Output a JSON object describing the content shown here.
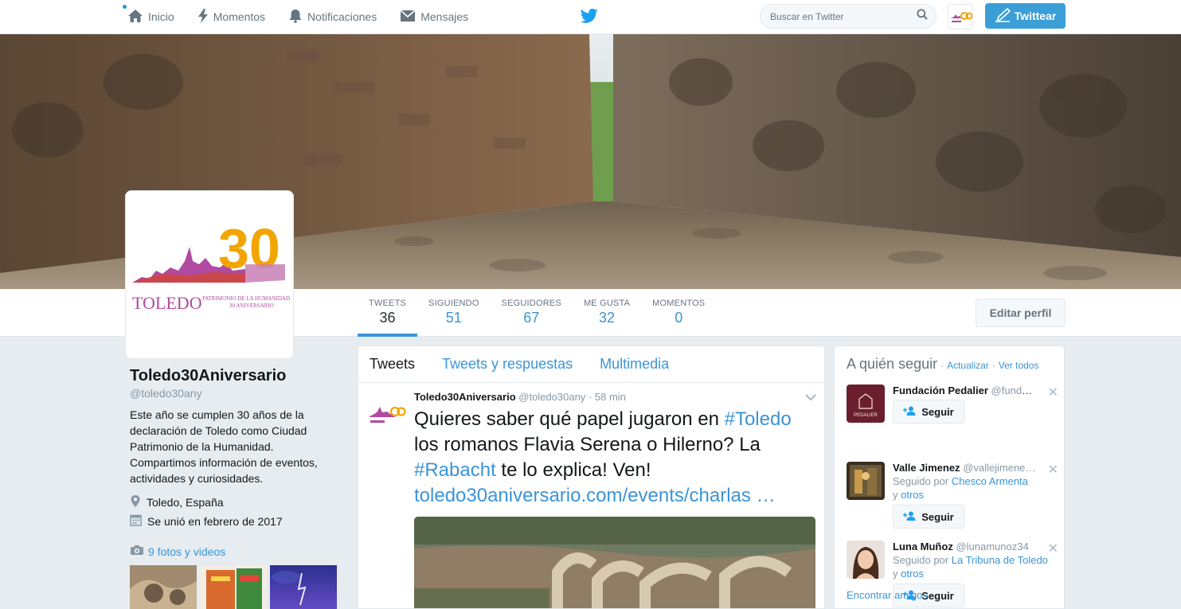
{
  "nav": {
    "home": "Inicio",
    "moments": "Momentos",
    "notifications": "Notificaciones",
    "messages": "Mensajes",
    "search_placeholder": "Buscar en Twitter",
    "tweet_button": "Twittear"
  },
  "profile": {
    "name": "Toledo30Aniversario",
    "handle": "@toledo30any",
    "bio": "Este año se cumplen 30 años de la declaración de Toledo como Ciudad Patrimonio de la Humanidad. Compartimos información de eventos, actividades y curiosidades.",
    "location": "Toledo, España",
    "joined": "Se unió en febrero de 2017",
    "photos_link": "9 fotos y videos",
    "logo_main": "TOLEDO",
    "logo_line1": "PATRIMONIO DE LA HUMANIDAD",
    "logo_line2": "30 ANIVERSARIO",
    "logo_number": "30"
  },
  "stats": [
    {
      "label": "TWEETS",
      "value": "36"
    },
    {
      "label": "SIGUIENDO",
      "value": "51"
    },
    {
      "label": "SEGUIDORES",
      "value": "67"
    },
    {
      "label": "ME GUSTA",
      "value": "32"
    },
    {
      "label": "MOMENTOS",
      "value": "0"
    }
  ],
  "edit_profile": "Editar perfil",
  "timeline": {
    "tabs": [
      "Tweets",
      "Tweets y respuestas",
      "Multimedia"
    ],
    "tweet": {
      "name": "Toledo30Aniversario",
      "handle": "@toledo30any",
      "sep": "·",
      "time": "58 min",
      "text1": "Quieres saber qué papel jugaron en ",
      "hashtag1": "#Toledo",
      "text2": " los romanos Flavia Serena o Hilerno? La ",
      "hashtag2": "#Rabacht",
      "text3": " te lo explica! Ven!",
      "link": "toledo30aniversario.com/events/charlas …"
    }
  },
  "who_to_follow": {
    "title": "A quién seguir",
    "dot": "·",
    "refresh": "Actualizar",
    "view_all": "Ver todos",
    "follow_label": "Seguir",
    "find_friends": "Encontrar amigos",
    "followed_by": "Seguido por",
    "and": "y",
    "others": "otros",
    "suggestions": [
      {
        "name": "Fundación Pedalier",
        "handle": "@fundp…",
        "logo_text": "PEDALIER"
      },
      {
        "name": "Valle Jimenez",
        "handle": "@vallejimene…",
        "followed_by": "Chesco Armenta"
      },
      {
        "name": "Luna Muñoz",
        "handle": "@lunamunoz34",
        "followed_by": "La Tribuna de Toledo"
      }
    ]
  },
  "colors": {
    "accent": "#3b94d9",
    "logo_orange": "#f2a500",
    "logo_purple": "#b14aa0"
  }
}
